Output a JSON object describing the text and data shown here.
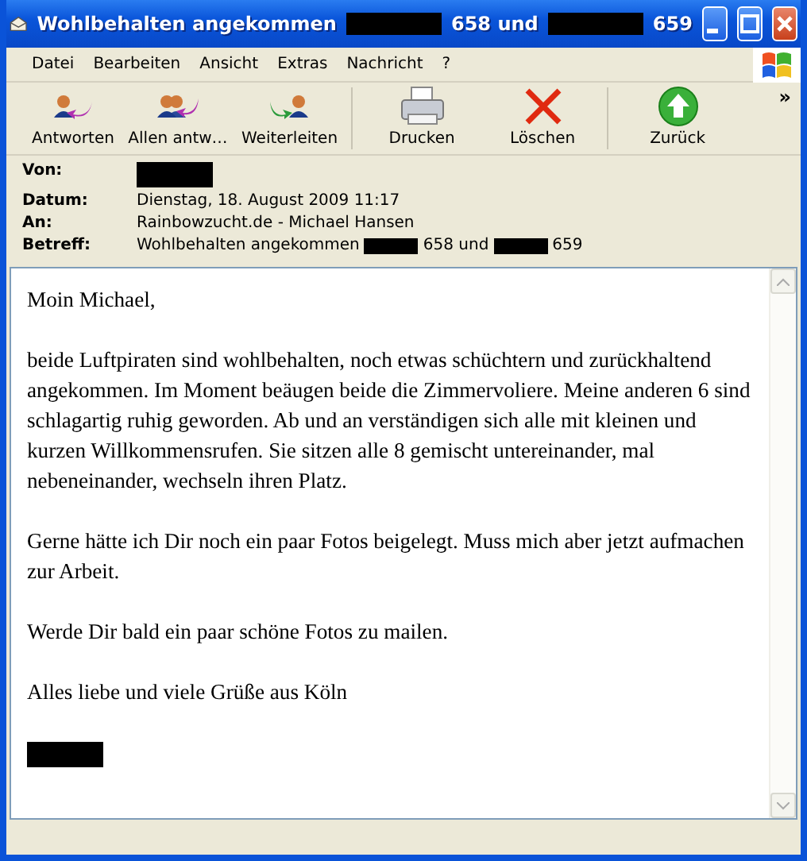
{
  "window": {
    "title": [
      {
        "kind": "text",
        "text": "Wohlbehalten angekommen"
      },
      {
        "kind": "redacted"
      },
      {
        "kind": "text",
        "text": "658 und"
      },
      {
        "kind": "redacted"
      },
      {
        "kind": "text",
        "text": "659"
      }
    ]
  },
  "menu": [
    "Datei",
    "Bearbeiten",
    "Ansicht",
    "Extras",
    "Nachricht",
    "?"
  ],
  "toolbar": [
    {
      "kind": "reply",
      "label": "Antworten"
    },
    {
      "kind": "reply_all",
      "label": "Allen antw…"
    },
    {
      "kind": "forward",
      "label": "Weiterleiten"
    },
    {
      "kind": "print",
      "label": "Drucken"
    },
    {
      "kind": "delete",
      "label": "Löschen"
    },
    {
      "kind": "back",
      "label": "Zurück"
    }
  ],
  "toolbar_more": "»",
  "headers": [
    {
      "label": "Von:",
      "value": [
        {
          "kind": "redacted"
        }
      ]
    },
    {
      "label": "Datum:",
      "value": [
        {
          "kind": "text",
          "text": "Dienstag, 18. August 2009 11:17"
        }
      ]
    },
    {
      "label": "An:",
      "value": [
        {
          "kind": "text",
          "text": "Rainbowzucht.de - Michael Hansen"
        }
      ]
    },
    {
      "label": "Betreff:",
      "value": [
        {
          "kind": "text",
          "text": "Wohlbehalten angekommen"
        },
        {
          "kind": "redacted"
        },
        {
          "kind": "text",
          "text": "658 und"
        },
        {
          "kind": "redacted"
        },
        {
          "kind": "text",
          "text": "659"
        }
      ]
    }
  ],
  "body": [
    {
      "kind": "text",
      "text": "Moin Michael,"
    },
    {
      "kind": "text",
      "text": "beide Luftpiraten sind wohlbehalten, noch etwas schüchtern und zurückhaltend angekommen. Im Moment beäugen beide die Zimmervoliere. Meine anderen 6 sind schlagartig ruhig geworden. Ab und an verständigen sich alle mit kleinen und kurzen Willkommensrufen. Sie sitzen alle 8 gemischt untereinander, mal nebeneinander, wechseln ihren Platz."
    },
    {
      "kind": "text",
      "text": "Gerne hätte ich Dir noch ein paar Fotos beigelegt. Muss mich aber jetzt aufmachen zur Arbeit."
    },
    {
      "kind": "text",
      "text": "Werde Dir bald ein paar schöne Fotos zu mailen."
    },
    {
      "kind": "text",
      "text": "Alles liebe und viele Grüße aus Köln"
    },
    {
      "kind": "redacted"
    }
  ]
}
